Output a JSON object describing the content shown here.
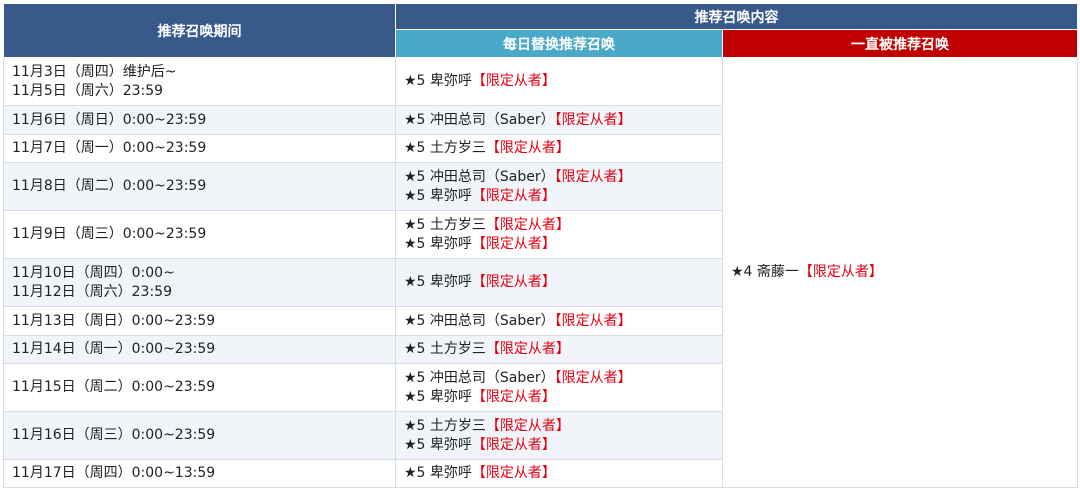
{
  "header": {
    "period": "推荐召唤期间",
    "content": "推荐召唤内容",
    "daily": "每日替换推荐召唤",
    "always": "一直被推荐召唤"
  },
  "rows": [
    {
      "period": [
        "11月3日（周四）维护后~",
        "11月5日（周六）23:59"
      ],
      "servants": [
        {
          "name": "★5 卑弥呼",
          "tag": "【限定从者】"
        }
      ]
    },
    {
      "period": [
        "11月6日（周日）0:00~23:59"
      ],
      "servants": [
        {
          "name": "★5 冲田总司（Saber）",
          "tag": "【限定从者】"
        }
      ]
    },
    {
      "period": [
        "11月7日（周一）0:00~23:59"
      ],
      "servants": [
        {
          "name": "★5 土方岁三",
          "tag": "【限定从者】"
        }
      ]
    },
    {
      "period": [
        "11月8日（周二）0:00~23:59"
      ],
      "servants": [
        {
          "name": "★5 冲田总司（Saber）",
          "tag": "【限定从者】"
        },
        {
          "name": "★5 卑弥呼",
          "tag": "【限定从者】"
        }
      ]
    },
    {
      "period": [
        "11月9日（周三）0:00~23:59"
      ],
      "servants": [
        {
          "name": "★5 土方岁三",
          "tag": "【限定从者】"
        },
        {
          "name": "★5 卑弥呼",
          "tag": "【限定从者】"
        }
      ]
    },
    {
      "period": [
        "11月10日（周四）0:00~",
        "11月12日（周六）23:59"
      ],
      "servants": [
        {
          "name": "★5 卑弥呼",
          "tag": "【限定从者】"
        }
      ]
    },
    {
      "period": [
        "11月13日（周日）0:00~23:59"
      ],
      "servants": [
        {
          "name": "★5 冲田总司（Saber）",
          "tag": "【限定从者】"
        }
      ]
    },
    {
      "period": [
        "11月14日（周一）0:00~23:59"
      ],
      "servants": [
        {
          "name": "★5 土方岁三",
          "tag": "【限定从者】"
        }
      ]
    },
    {
      "period": [
        "11月15日（周二）0:00~23:59"
      ],
      "servants": [
        {
          "name": "★5 冲田总司（Saber）",
          "tag": "【限定从者】"
        },
        {
          "name": "★5 卑弥呼",
          "tag": "【限定从者】"
        }
      ]
    },
    {
      "period": [
        "11月16日（周三）0:00~23:59"
      ],
      "servants": [
        {
          "name": "★5 土方岁三",
          "tag": "【限定从者】"
        },
        {
          "name": "★5 卑弥呼",
          "tag": "【限定从者】"
        }
      ]
    },
    {
      "period": [
        "11月17日（周四）0:00~13:59"
      ],
      "servants": [
        {
          "name": "★5 卑弥呼",
          "tag": "【限定从者】"
        }
      ]
    }
  ],
  "always": {
    "name": "★4 斋藤一",
    "tag": "【限定从者】"
  }
}
